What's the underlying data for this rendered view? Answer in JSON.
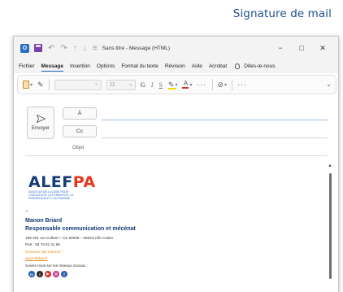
{
  "page": {
    "heading": "Signature de mail"
  },
  "titlebar": {
    "undo_glyph": "↶",
    "redo_glyph": "↷",
    "up_glyph": "↑",
    "down_glyph": "↓",
    "customize_glyph": "≡",
    "title": "Sans titre - Message (HTML)",
    "minimize_glyph": "−",
    "maximize_glyph": "□",
    "close_glyph": "✕"
  },
  "menu": {
    "items": [
      "Fichier",
      "Message",
      "Insertion",
      "Options",
      "Format du texte",
      "Révision",
      "Aide",
      "Acrobat"
    ],
    "active": "Message",
    "search": "Dites-le-nous"
  },
  "ribbon": {
    "font_size": "11",
    "bold": "G",
    "italic": "I",
    "underline": "S",
    "font_color": "A",
    "more": "···",
    "attach": "⊘",
    "more2": "···",
    "expand": "⌄"
  },
  "compose": {
    "send_label": "Envoyer",
    "to_label": "À",
    "cc_label": "Cc",
    "subject_label": "Objet"
  },
  "signature": {
    "logo_main": "ALEF",
    "logo_accent": "PA",
    "logo_tagline": "Association lilloise pour l'éducation, la formation, la prévention et l'autonomie",
    "dashes": "--",
    "name": "Manon Briard",
    "role": "Responsable communication et mécénat",
    "address": "199-201 rue Colbert – CS 60036 – 59043 Lille Cedex",
    "phone": "Port : 06 78 91 31 66",
    "website_label": "Nouveau site internet !",
    "website": "www.alefpa.fr",
    "social_label": "Suivez-nous sur les réseaux sociaux :",
    "social_icons": [
      {
        "name": "linkedin-icon",
        "glyph": "in",
        "color": "#1f5fa8"
      },
      {
        "name": "twitter-icon",
        "glyph": "t",
        "color": "#2a2a2a"
      },
      {
        "name": "youtube-icon",
        "glyph": "▶",
        "color": "#d92b2b"
      },
      {
        "name": "instagram-icon",
        "glyph": "◎",
        "color": "#c2398f"
      },
      {
        "name": "facebook-icon",
        "glyph": "f",
        "color": "#2d5fb5"
      }
    ]
  }
}
